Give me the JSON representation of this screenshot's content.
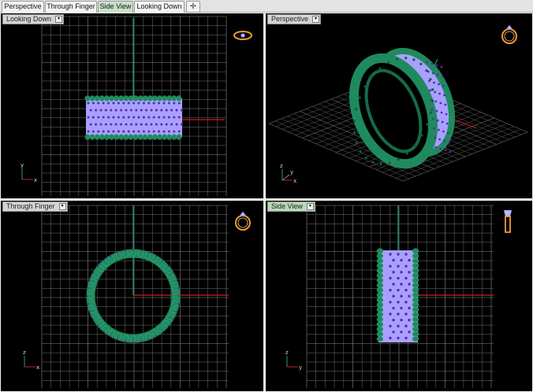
{
  "tabs": [
    {
      "label": "Perspective",
      "active": false
    },
    {
      "label": "Through Finger",
      "active": false
    },
    {
      "label": "Side View",
      "active": true
    },
    {
      "label": "Looking Down",
      "active": false
    }
  ],
  "add_tab_label": "✛",
  "viewports": {
    "top_left": {
      "label": "Looking Down",
      "active": false,
      "axis_h": "x",
      "axis_v": "y"
    },
    "top_right": {
      "label": "Perspective",
      "active": false,
      "axis_h": "x",
      "axis_v": "y",
      "axis_up": "z"
    },
    "bottom_left": {
      "label": "Through Finger",
      "active": false,
      "axis_h": "x",
      "axis_v": "z"
    },
    "bottom_right": {
      "label": "Side View",
      "active": true,
      "axis_h": "y",
      "axis_v": "z"
    }
  },
  "menu_arrow": "▾",
  "colors": {
    "grid": "#5c5c5c",
    "grid_major": "#8a8a8a",
    "axis_x": "#cc2222",
    "axis_y": "#1fa080",
    "ring_green": "#1f8a5e",
    "gem_lavender": "#a8a0ff",
    "gem_purple": "#5b2aa8",
    "widget_orange": "#f09a30"
  },
  "icons": [
    "ring-widget-icon",
    "perspective-ring-widget-icon",
    "front-ring-widget-icon",
    "side-ring-widget-icon",
    "dropdown-arrow-icon"
  ]
}
